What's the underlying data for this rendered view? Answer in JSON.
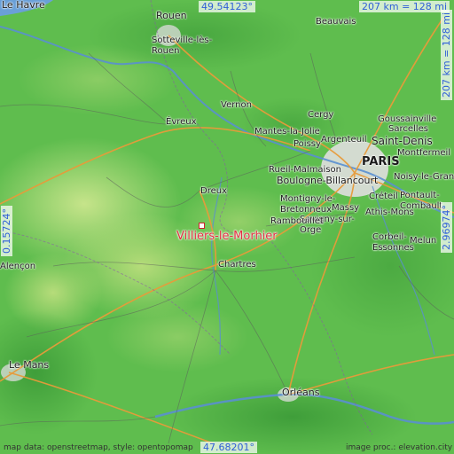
{
  "map": {
    "highlight_place": "Villiers-le-Morhier",
    "coords": {
      "top_lat": "49.54123°",
      "bottom_lat": "47.68201°",
      "left_lon": "0.15724°",
      "right_lon": "2.96974°"
    },
    "scale": {
      "horizontal": "207 km = 128 mi",
      "vertical": "207 km = 128 mi"
    },
    "footer": {
      "left": "map data: openstreetmap, style: opentopomap",
      "right": "image proc.: elevation.city"
    },
    "places": [
      "Le Havre",
      "Rouen",
      "Beauvais",
      "Sotteville-lès-Rouen",
      "Évreux",
      "Vernon",
      "Cergy",
      "Sarcelles",
      "Goussainville",
      "Mantes-la-Jolie",
      "Poissy",
      "Argenteuil",
      "Saint-Denis",
      "Montfermeil",
      "PARIS",
      "Rueil-Malmaison",
      "Boulogne-Billancourt",
      "Noisy-le-Grand",
      "Dreux",
      "Montigny-le-Bretonneux",
      "Créteil",
      "Massy",
      "Pontault-Combault",
      "Savigny-sur-Orge",
      "Athis-Mons",
      "Rambouillet",
      "Corbeil-Essonnes",
      "Melun",
      "Chartres",
      "Alençon",
      "Le Mans",
      "Orléans"
    ],
    "colors": {
      "lowland": "#5fbd4e",
      "upland": "#a8d86a",
      "coord_text": "#2f5fd8",
      "highlight": "#e03040",
      "urban": "#e8e0e8",
      "water": "#6aa0d8"
    }
  }
}
